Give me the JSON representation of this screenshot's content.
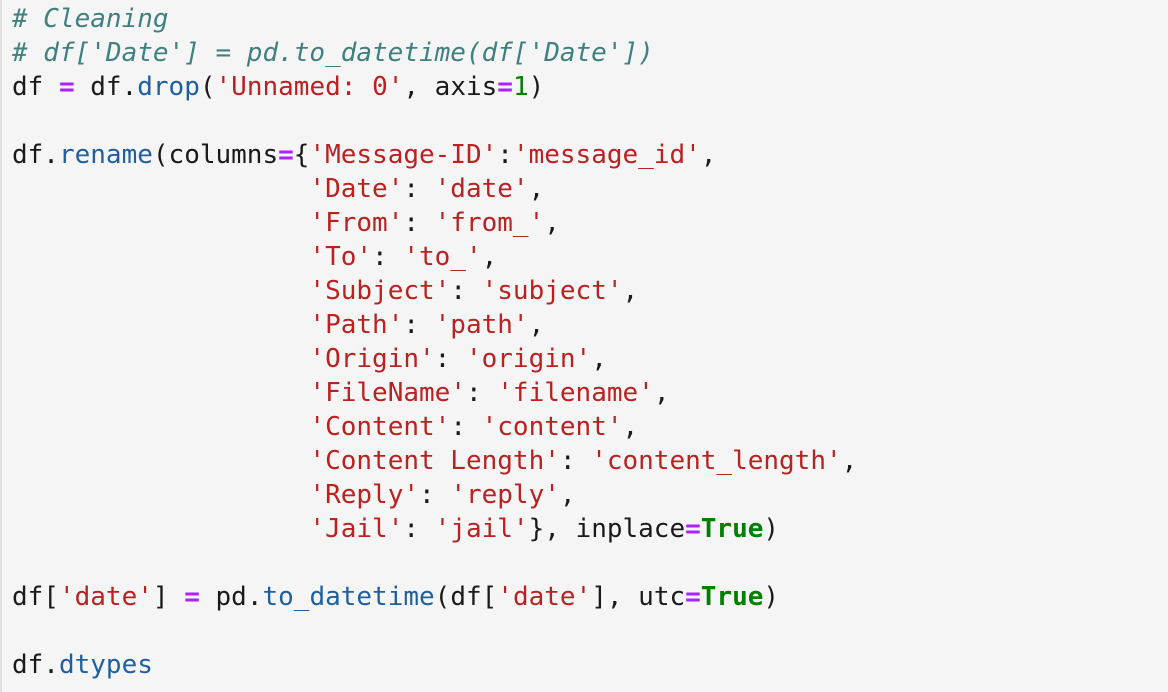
{
  "code_cell": {
    "language": "python",
    "lines": [
      [
        {
          "t": "# Cleaning",
          "k": "comment"
        }
      ],
      [
        {
          "t": "# df['Date'] = pd.to_datetime(df['Date'])",
          "k": "comment"
        }
      ],
      [
        {
          "t": "df ",
          "k": "name"
        },
        {
          "t": "=",
          "k": "op"
        },
        {
          "t": " df.",
          "k": "name"
        },
        {
          "t": "drop",
          "k": "attr"
        },
        {
          "t": "(",
          "k": "name"
        },
        {
          "t": "'Unnamed: 0'",
          "k": "str"
        },
        {
          "t": ", axis",
          "k": "name"
        },
        {
          "t": "=",
          "k": "op"
        },
        {
          "t": "1",
          "k": "num"
        },
        {
          "t": ")",
          "k": "name"
        }
      ],
      [],
      [
        {
          "t": "df.",
          "k": "name"
        },
        {
          "t": "rename",
          "k": "attr"
        },
        {
          "t": "(columns",
          "k": "name"
        },
        {
          "t": "=",
          "k": "op"
        },
        {
          "t": "{",
          "k": "name"
        },
        {
          "t": "'Message-ID'",
          "k": "str"
        },
        {
          "t": ":",
          "k": "name"
        },
        {
          "t": "'message_id'",
          "k": "str"
        },
        {
          "t": ",",
          "k": "name"
        }
      ],
      [
        {
          "t": "                   ",
          "k": "name"
        },
        {
          "t": "'Date'",
          "k": "str"
        },
        {
          "t": ": ",
          "k": "name"
        },
        {
          "t": "'date'",
          "k": "str"
        },
        {
          "t": ",",
          "k": "name"
        }
      ],
      [
        {
          "t": "                   ",
          "k": "name"
        },
        {
          "t": "'From'",
          "k": "str"
        },
        {
          "t": ": ",
          "k": "name"
        },
        {
          "t": "'from_'",
          "k": "str"
        },
        {
          "t": ",",
          "k": "name"
        }
      ],
      [
        {
          "t": "                   ",
          "k": "name"
        },
        {
          "t": "'To'",
          "k": "str"
        },
        {
          "t": ": ",
          "k": "name"
        },
        {
          "t": "'to_'",
          "k": "str"
        },
        {
          "t": ",",
          "k": "name"
        }
      ],
      [
        {
          "t": "                   ",
          "k": "name"
        },
        {
          "t": "'Subject'",
          "k": "str"
        },
        {
          "t": ": ",
          "k": "name"
        },
        {
          "t": "'subject'",
          "k": "str"
        },
        {
          "t": ",",
          "k": "name"
        }
      ],
      [
        {
          "t": "                   ",
          "k": "name"
        },
        {
          "t": "'Path'",
          "k": "str"
        },
        {
          "t": ": ",
          "k": "name"
        },
        {
          "t": "'path'",
          "k": "str"
        },
        {
          "t": ",",
          "k": "name"
        }
      ],
      [
        {
          "t": "                   ",
          "k": "name"
        },
        {
          "t": "'Origin'",
          "k": "str"
        },
        {
          "t": ": ",
          "k": "name"
        },
        {
          "t": "'origin'",
          "k": "str"
        },
        {
          "t": ",",
          "k": "name"
        }
      ],
      [
        {
          "t": "                   ",
          "k": "name"
        },
        {
          "t": "'FileName'",
          "k": "str"
        },
        {
          "t": ": ",
          "k": "name"
        },
        {
          "t": "'filename'",
          "k": "str"
        },
        {
          "t": ",",
          "k": "name"
        }
      ],
      [
        {
          "t": "                   ",
          "k": "name"
        },
        {
          "t": "'Content'",
          "k": "str"
        },
        {
          "t": ": ",
          "k": "name"
        },
        {
          "t": "'content'",
          "k": "str"
        },
        {
          "t": ",",
          "k": "name"
        }
      ],
      [
        {
          "t": "                   ",
          "k": "name"
        },
        {
          "t": "'Content Length'",
          "k": "str"
        },
        {
          "t": ": ",
          "k": "name"
        },
        {
          "t": "'content_length'",
          "k": "str"
        },
        {
          "t": ",",
          "k": "name"
        }
      ],
      [
        {
          "t": "                   ",
          "k": "name"
        },
        {
          "t": "'Reply'",
          "k": "str"
        },
        {
          "t": ": ",
          "k": "name"
        },
        {
          "t": "'reply'",
          "k": "str"
        },
        {
          "t": ",",
          "k": "name"
        }
      ],
      [
        {
          "t": "                   ",
          "k": "name"
        },
        {
          "t": "'Jail'",
          "k": "str"
        },
        {
          "t": ": ",
          "k": "name"
        },
        {
          "t": "'jail'",
          "k": "str"
        },
        {
          "t": "}, inplace",
          "k": "name"
        },
        {
          "t": "=",
          "k": "op"
        },
        {
          "t": "True",
          "k": "kw"
        },
        {
          "t": ")",
          "k": "name"
        }
      ],
      [],
      [
        {
          "t": "df[",
          "k": "name"
        },
        {
          "t": "'date'",
          "k": "str"
        },
        {
          "t": "] ",
          "k": "name"
        },
        {
          "t": "=",
          "k": "op"
        },
        {
          "t": " pd.",
          "k": "name"
        },
        {
          "t": "to_datetime",
          "k": "attr"
        },
        {
          "t": "(df[",
          "k": "name"
        },
        {
          "t": "'date'",
          "k": "str"
        },
        {
          "t": "], utc",
          "k": "name"
        },
        {
          "t": "=",
          "k": "op"
        },
        {
          "t": "True",
          "k": "kw"
        },
        {
          "t": ")",
          "k": "name"
        }
      ],
      [],
      [
        {
          "t": "df.",
          "k": "name"
        },
        {
          "t": "dtypes",
          "k": "attr"
        }
      ]
    ]
  },
  "colors": {
    "background": "#f5f5f5",
    "comment": "#408080",
    "operator": "#aa22ff",
    "string": "#ba2121",
    "number": "#008000",
    "keyword": "#008000",
    "attribute": "#1f5f9f",
    "text": "#1a1a1a"
  }
}
